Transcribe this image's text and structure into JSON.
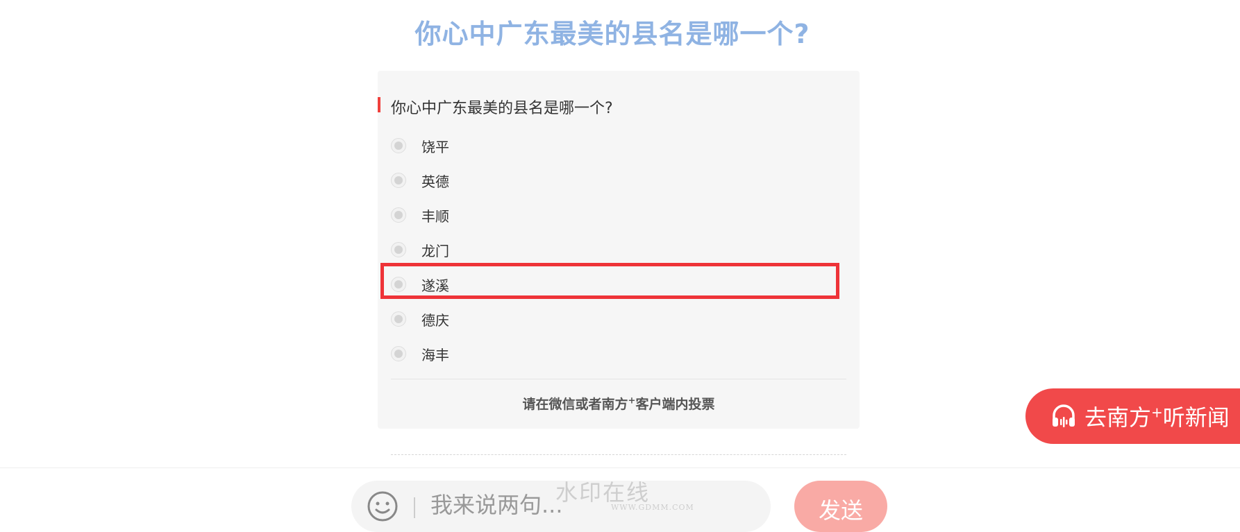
{
  "title": "你心中广东最美的县名是哪一个?",
  "poll": {
    "question": "你心中广东最美的县名是哪一个?",
    "options": [
      "饶平",
      "英德",
      "丰顺",
      "龙门",
      "遂溪",
      "德庆",
      "海丰"
    ],
    "notice_prefix": "请在微信或者南方",
    "notice_plus": "+",
    "notice_suffix": "客户端内投票"
  },
  "listen_button": {
    "prefix": "去南方",
    "plus": "+",
    "suffix": "听新闻"
  },
  "comment": {
    "placeholder": "我来说两句..."
  },
  "send_button": {
    "label": "发送"
  },
  "watermark": {
    "main": "水印在线",
    "sub": "WWW.GDMM.COM"
  },
  "colors": {
    "title": "#8fb3e3",
    "accent": "#f1494a",
    "highlight": "#ee3338",
    "send": "#f9aaa5"
  },
  "icons": {
    "listen": "headphones-icon",
    "emoji": "smiley-icon"
  }
}
